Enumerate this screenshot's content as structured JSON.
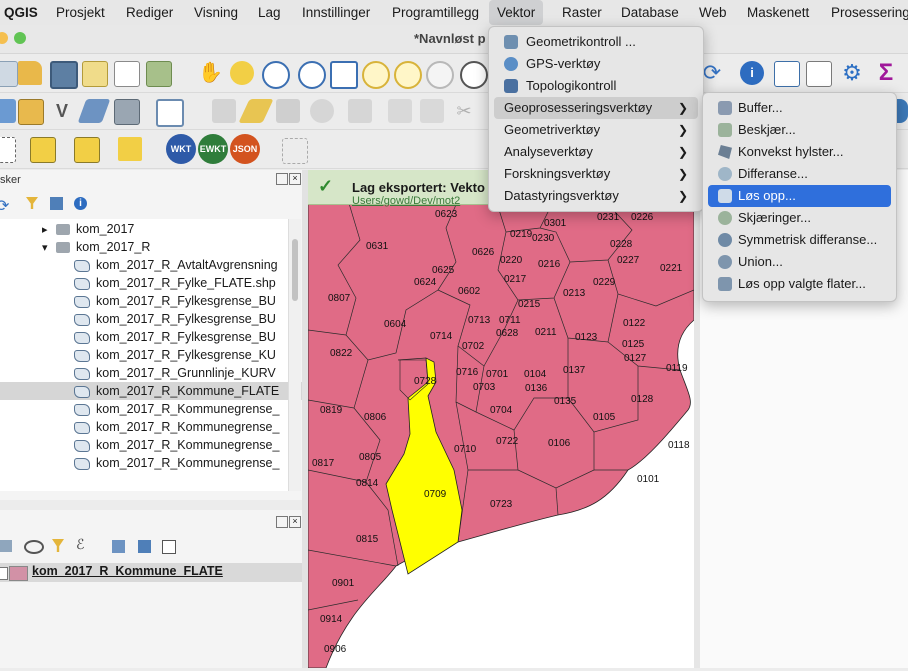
{
  "menubar": {
    "app": "QGIS",
    "items": [
      "Prosjekt",
      "Rediger",
      "Visning",
      "Lag",
      "Innstillinger",
      "Programtillegg",
      "Vektor",
      "Raster",
      "Database",
      "Web",
      "Maskenett",
      "Prosessering"
    ],
    "active": "Vektor"
  },
  "window": {
    "title": "*Navnløst p"
  },
  "toolbar3": {
    "wkt": "WKT",
    "ewkt": "EWKT",
    "json": "JSON"
  },
  "browser": {
    "title": "sker",
    "rows": [
      {
        "label": "kom_2017",
        "kind": "folder",
        "arrow": "▸"
      },
      {
        "label": "kom_2017_R",
        "kind": "folder",
        "arrow": "▾"
      },
      {
        "label": "kom_2017_R_AvtaltAvgrensning",
        "kind": "layer"
      },
      {
        "label": "kom_2017_R_Fylke_FLATE.shp",
        "kind": "layer"
      },
      {
        "label": "kom_2017_R_Fylkesgrense_BU",
        "kind": "layer"
      },
      {
        "label": "kom_2017_R_Fylkesgrense_BU",
        "kind": "layer"
      },
      {
        "label": "kom_2017_R_Fylkesgrense_BU",
        "kind": "layer"
      },
      {
        "label": "kom_2017_R_Fylkesgrense_KU",
        "kind": "layer"
      },
      {
        "label": "kom_2017_R_Grunnlinje_KURV",
        "kind": "layer"
      },
      {
        "label": "kom_2017_R_Kommune_FLATE",
        "kind": "layer",
        "selected": true
      },
      {
        "label": "kom_2017_R_Kommunegrense_",
        "kind": "layer"
      },
      {
        "label": "kom_2017_R_Kommunegrense_",
        "kind": "layer"
      },
      {
        "label": "kom_2017_R_Kommunegrense_",
        "kind": "layer"
      },
      {
        "label": "kom_2017_R_Kommunegrense_",
        "kind": "layer"
      }
    ]
  },
  "layers": {
    "layer_name": "kom_2017_R_Kommune_FLATE",
    "swatch_color": "#d291a6"
  },
  "map": {
    "banner_title": "Lag eksportert: Vekto",
    "banner_path": "Users/gowd/Dev/mot2",
    "fill_color": "#e06b86",
    "highlight_color": "#ffff00",
    "labels": [
      "0623",
      "0219",
      "0301",
      "0231",
      "0226",
      "0631",
      "0626",
      "0220",
      "0230",
      "0228",
      "0625",
      "0216",
      "0227",
      "0221",
      "0624",
      "0602",
      "0217",
      "0229",
      "0213",
      "0807",
      "0215",
      "0604",
      "0713",
      "0711",
      "0211",
      "0122",
      "0714",
      "0628",
      "0123",
      "0127",
      "0125",
      "0822",
      "0702",
      "0728",
      "0716",
      "0701",
      "0104",
      "0137",
      "0119",
      "0703",
      "0136",
      "0819",
      "0806",
      "0135",
      "0128",
      "0704",
      "0105",
      "0805",
      "0722",
      "0710",
      "0118",
      "0106",
      "0814",
      "0709",
      "0101",
      "0723",
      "0815",
      "0901",
      "0914",
      "0906",
      "0817"
    ]
  },
  "vektor_menu": {
    "items": [
      {
        "label": "Geometrikontroll ...",
        "has_icon": true
      },
      {
        "label": "GPS-verktøy",
        "has_icon": true
      },
      {
        "label": "Topologikontroll",
        "has_icon": true
      },
      {
        "label": "Geoprosesseringsverktøy",
        "submenu": true,
        "highlighted": true
      },
      {
        "label": "Geometriverktøy",
        "submenu": true
      },
      {
        "label": "Analyseverktøy",
        "submenu": true
      },
      {
        "label": "Forskningsverktøy",
        "submenu": true
      },
      {
        "label": "Datastyringsverktøy",
        "submenu": true
      }
    ]
  },
  "geoprocessing_menu": {
    "items": [
      {
        "label": "Buffer...",
        "icon": "buffer-icon"
      },
      {
        "label": "Beskjær...",
        "icon": "clip-icon"
      },
      {
        "label": "Konvekst hylster...",
        "icon": "convex-hull-icon"
      },
      {
        "label": "Differanse...",
        "icon": "difference-icon"
      },
      {
        "label": "Løs opp...",
        "icon": "dissolve-icon",
        "selected": true
      },
      {
        "label": "Skjæringer...",
        "icon": "intersection-icon"
      },
      {
        "label": "Symmetrisk differanse...",
        "icon": "sym-difference-icon"
      },
      {
        "label": "Union...",
        "icon": "union-icon"
      },
      {
        "label": "Løs opp valgte flater...",
        "icon": "dissolve-selected-icon"
      }
    ]
  },
  "colors": {
    "menu_select": "#2f6fdc",
    "submenu_hover": "#cdcdcd"
  }
}
